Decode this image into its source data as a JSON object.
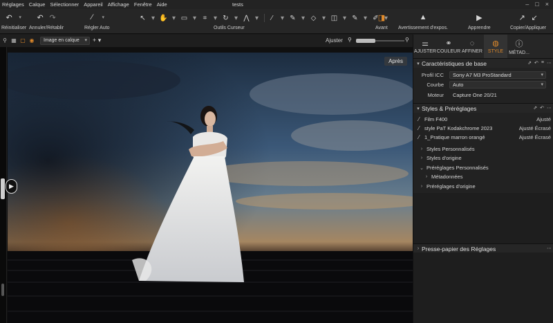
{
  "menu": [
    "Réglages",
    "Calque",
    "Sélectionner",
    "Appareil",
    "Affichage",
    "Fenêtre",
    "Aide"
  ],
  "window_title": "tests",
  "toolbar": {
    "reset_label": "Réinitialiser",
    "undo_label": "Annuler/Rétablir",
    "auto_label": "Régler Auto",
    "cursor_label": "Outils Curseur",
    "before_label": "Avant",
    "exposure_warning_label": "Avertissement d'expos.",
    "learn_label": "Apprendre",
    "copy_apply_label": "Copier/Appliquer"
  },
  "viewbar": {
    "layer_select": "Image en calque",
    "fit_label": "Ajuster",
    "zoom_fraction": 0.4
  },
  "viewer": {
    "after_label": "Après"
  },
  "tabs": [
    {
      "label": "AJUSTER",
      "icon": "sliders-icon"
    },
    {
      "label": "COULEUR",
      "icon": "color-circles-icon"
    },
    {
      "label": "AFFINER",
      "icon": "refine-icon"
    },
    {
      "label": "STYLE",
      "icon": "style-icon",
      "active": true
    },
    {
      "label": "MÉTAD...",
      "icon": "info-icon"
    }
  ],
  "basic": {
    "title": "Caractéristiques de base",
    "icc_label": "Profil ICC",
    "icc_value": "Sony A7 M3 ProStandard",
    "curve_label": "Courbe",
    "curve_value": "Auto",
    "engine_label": "Moteur",
    "engine_value": "Capture One 20/21"
  },
  "styles": {
    "title": "Styles & Préréglages",
    "applied": [
      {
        "name": "Film F400",
        "state": "Ajusté"
      },
      {
        "name": "style PaT Kodakchrome 2023",
        "state": "Ajusté Écrasé"
      },
      {
        "name": "1_Pratique marron orangé",
        "state": "Ajusté Écrasé"
      }
    ],
    "tree": [
      {
        "label": "Styles Personnalisés",
        "open": false,
        "child": false
      },
      {
        "label": "Styles d'origine",
        "open": false,
        "child": false
      },
      {
        "label": "Préréglages Personnalisés",
        "open": true,
        "child": false
      },
      {
        "label": "Métadonnées",
        "open": false,
        "child": true
      },
      {
        "label": "Préréglages d'origine",
        "open": false,
        "child": false
      }
    ]
  },
  "clipboard": {
    "title": "Presse-papier des Réglages"
  },
  "colors": {
    "accent": "#e08a2b",
    "panel": "#222222"
  }
}
